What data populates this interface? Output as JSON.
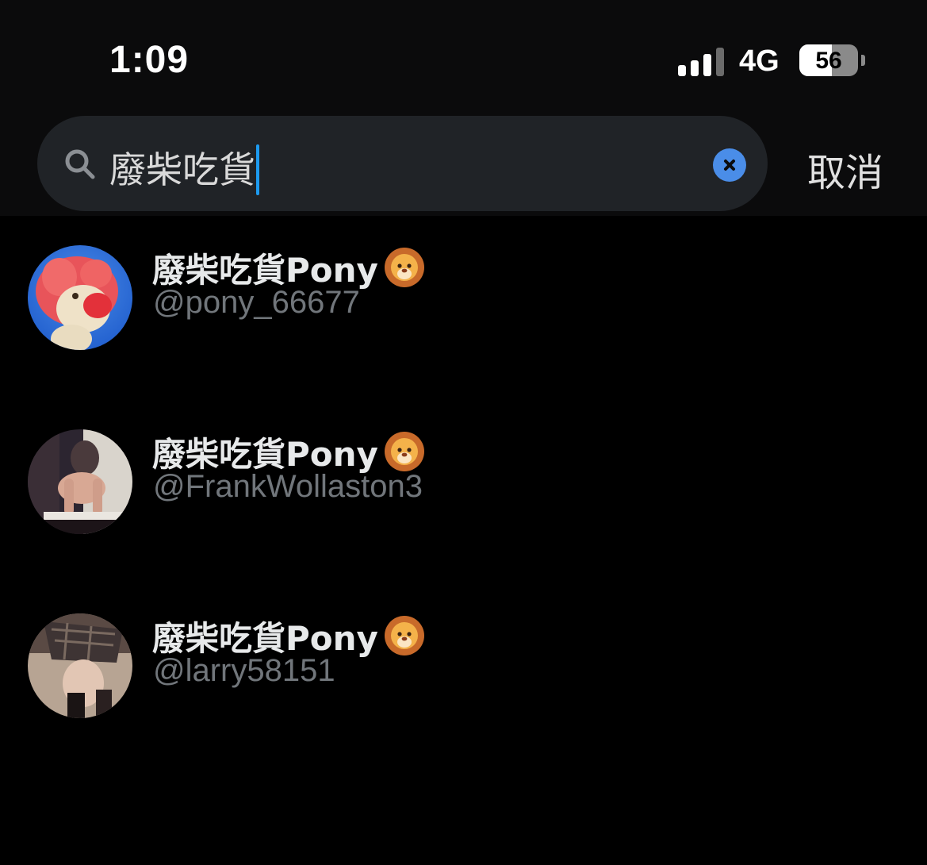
{
  "status_bar": {
    "time": "1:09",
    "network": "4G",
    "battery_percent": "56",
    "battery_level": 0.56,
    "signal_bars_active": 3,
    "signal_bars_total": 4
  },
  "search": {
    "value": "廢柴吃貨",
    "icon": "search-icon",
    "clear_icon": "close-icon",
    "cancel_label": "取消"
  },
  "results": [
    {
      "display_name": "廢柴吃貨Pony",
      "emoji": "lion-face-icon",
      "handle": "@pony_66677",
      "avatar": "red-lion-plush-photo"
    },
    {
      "display_name": "廢柴吃貨Pony",
      "emoji": "lion-face-icon",
      "handle": "@FrankWollaston3",
      "avatar": "seated-person-photo"
    },
    {
      "display_name": "廢柴吃貨Pony",
      "emoji": "lion-face-icon",
      "handle": "@larry58151",
      "avatar": "plaid-skirt-photo"
    }
  ],
  "colors": {
    "background": "#000000",
    "search_field": "#202327",
    "accent": "#1d9bf0",
    "clear_button": "#4a8de8",
    "secondary_text": "#71767b"
  }
}
